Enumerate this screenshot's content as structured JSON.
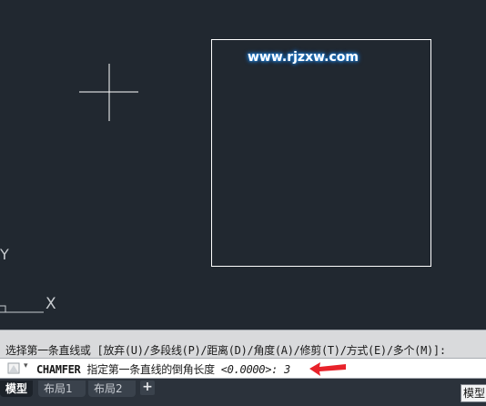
{
  "canvas": {
    "background": "#212830",
    "watermark": "www.rjzxw.com",
    "ucs_y_label": "Y",
    "ucs_x_label": "X"
  },
  "command_history": {
    "text": "选择第一条直线或 [放弃(U)/多段线(P)/距离(D)/角度(A)/修剪(T)/方式(E)/多个(M)]:"
  },
  "command_line": {
    "icon": "command-icon",
    "dropdown_icon": "chevron-down-icon",
    "command_name": "CHAMFER",
    "prompt": " 指定第一条直线的倒角长度 ",
    "default_value": "<0.0000>:",
    "input_value": "3",
    "annotation_color": "#e8222a"
  },
  "layout_tabs": {
    "tabs": [
      "模型",
      "布局1",
      "布局2"
    ],
    "add_icon": "+"
  },
  "status_bar": {
    "model_label": "模型"
  }
}
